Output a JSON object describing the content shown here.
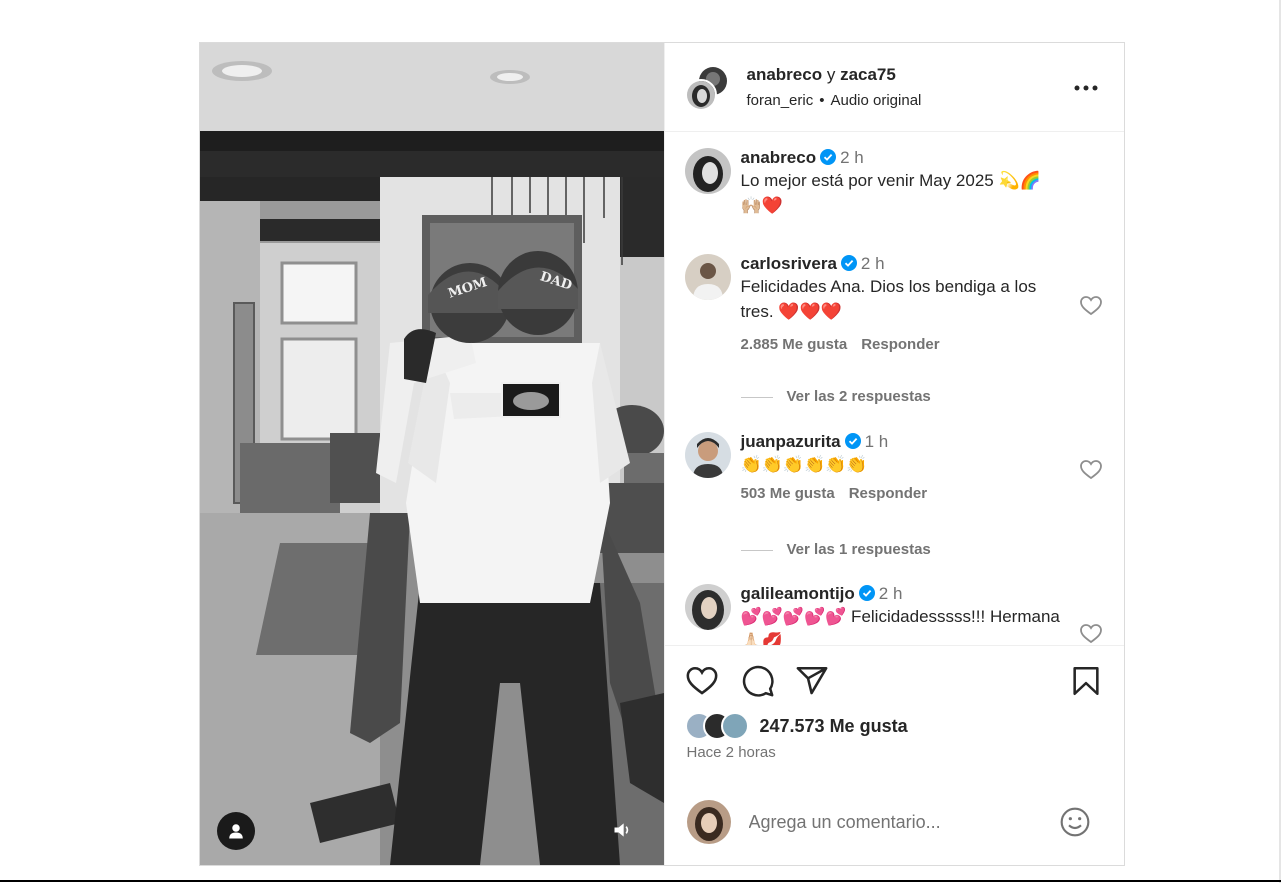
{
  "header": {
    "user1": "anabreco",
    "joiner": "y",
    "user2": "zaca75",
    "audio_user": "foran_eric",
    "audio_label": "Audio original"
  },
  "media": {
    "cap_left_text": "MOM",
    "cap_right_text": "DAD"
  },
  "caption": {
    "user": "anabreco",
    "time": "2 h",
    "text": "Lo mejor está por venir May 2025 💫🌈",
    "text2": "🙌🏼❤️"
  },
  "comments": [
    {
      "user": "carlosrivera",
      "time": "2 h",
      "text": "Felicidades Ana. Dios los bendiga a los tres. ❤️❤️❤️",
      "likes": "2.885 Me gusta",
      "reply_label": "Responder",
      "view_replies": "Ver las 2 respuestas"
    },
    {
      "user": "juanpazurita",
      "time": "1 h",
      "text": "👏👏👏👏👏👏",
      "likes": "503 Me gusta",
      "reply_label": "Responder",
      "view_replies": "Ver las 1 respuestas"
    },
    {
      "user": "galileamontijo",
      "time": "2 h",
      "text": "💕💕💕💕💕 Felicidadesssss!!! Hermana 🙏🏻💋"
    }
  ],
  "footer": {
    "likes": "247.573 Me gusta",
    "time_ago": "Hace 2 horas",
    "add_comment_placeholder": "Agrega un comentario..."
  },
  "icons": {
    "more": "more-icon",
    "verified": "verified-badge-icon",
    "heart": "heart-icon",
    "comment": "comment-icon",
    "share": "share-icon",
    "bookmark": "bookmark-icon",
    "emoji": "emoji-icon",
    "user_tag": "user-tag-icon",
    "audio": "speaker-icon"
  },
  "colors": {
    "verified": "#0095f6",
    "muted_text": "#737373",
    "border": "#dbdbdb"
  }
}
